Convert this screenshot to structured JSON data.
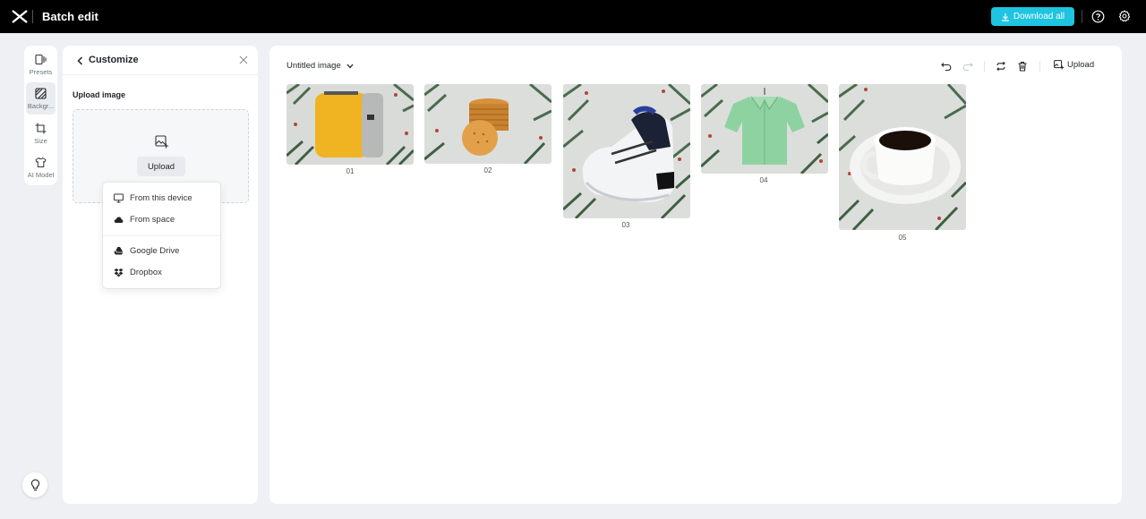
{
  "topbar": {
    "title": "Batch edit",
    "download_label": "Download all",
    "accent": "#1ec4e0"
  },
  "rail": {
    "items": [
      {
        "label": "Presets",
        "icon": "presets-icon"
      },
      {
        "label": "Backgr...",
        "icon": "background-icon"
      },
      {
        "label": "Size",
        "icon": "crop-icon"
      },
      {
        "label": "AI Model",
        "icon": "shirt-icon"
      }
    ]
  },
  "panel": {
    "title": "Customize",
    "section_label": "Upload image",
    "upload_label": "Upload"
  },
  "menu": {
    "items": [
      {
        "label": "From this device",
        "icon": "monitor-icon"
      },
      {
        "label": "From space",
        "icon": "cloud-icon"
      },
      {
        "label": "Google Drive",
        "icon": "google-drive-icon"
      },
      {
        "label": "Dropbox",
        "icon": "dropbox-icon"
      }
    ]
  },
  "main": {
    "doc_title": "Untitled image",
    "upload_label": "Upload",
    "images": [
      {
        "label": "01",
        "subject": "yellow toaster"
      },
      {
        "label": "02",
        "subject": "stack of crackers"
      },
      {
        "label": "03",
        "subject": "sneaker"
      },
      {
        "label": "04",
        "subject": "green shirt"
      },
      {
        "label": "05",
        "subject": "coffee cup"
      }
    ]
  }
}
